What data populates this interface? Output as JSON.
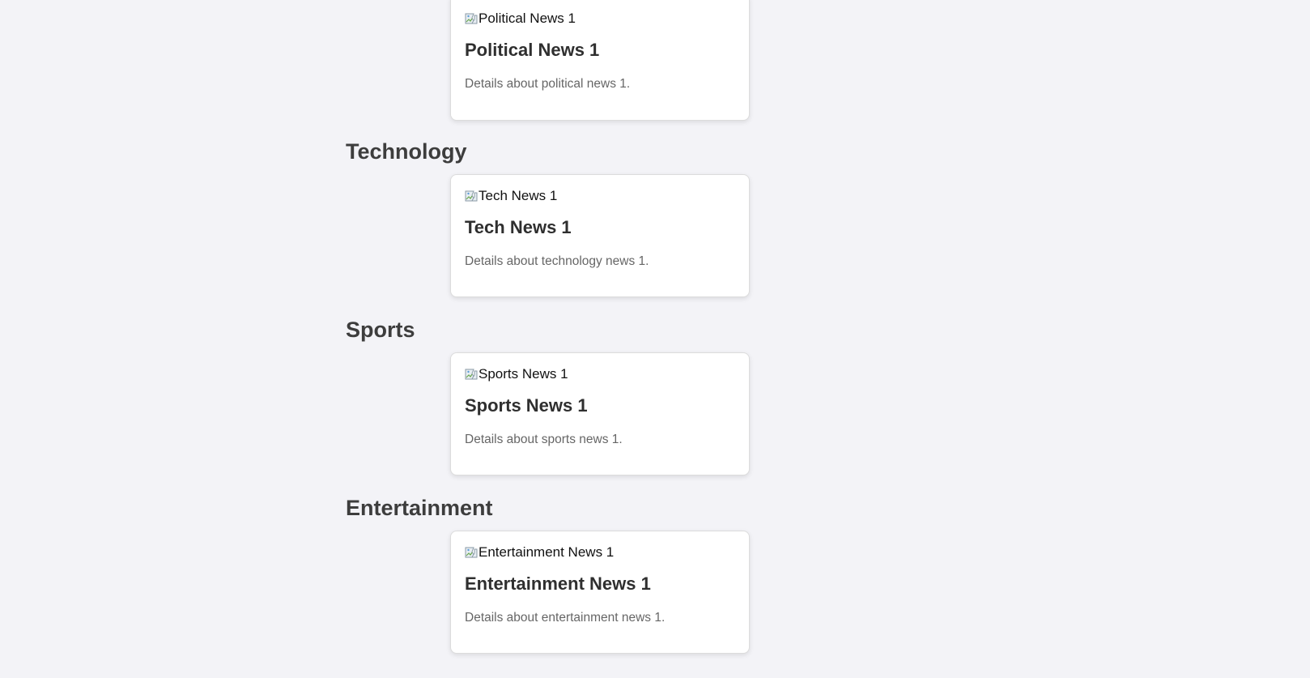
{
  "sections": [
    {
      "title": "",
      "articles": [
        {
          "image_alt": "Political News 1",
          "title": "Political News 1",
          "description": "Details about political news 1."
        }
      ]
    },
    {
      "title": "Technology",
      "articles": [
        {
          "image_alt": "Tech News 1",
          "title": "Tech News 1",
          "description": "Details about technology news 1."
        }
      ]
    },
    {
      "title": "Sports",
      "articles": [
        {
          "image_alt": "Sports News 1",
          "title": "Sports News 1",
          "description": "Details about sports news 1."
        }
      ]
    },
    {
      "title": "Entertainment",
      "articles": [
        {
          "image_alt": "Entertainment News 1",
          "title": "Entertainment News 1",
          "description": "Details about entertainment news 1."
        }
      ]
    }
  ],
  "icons": {
    "broken_image": "broken-image-icon"
  },
  "colors": {
    "page_background": "#f3f3f7",
    "card_background": "#ffffff",
    "heading": "#3d3d3d",
    "description": "#666666"
  }
}
